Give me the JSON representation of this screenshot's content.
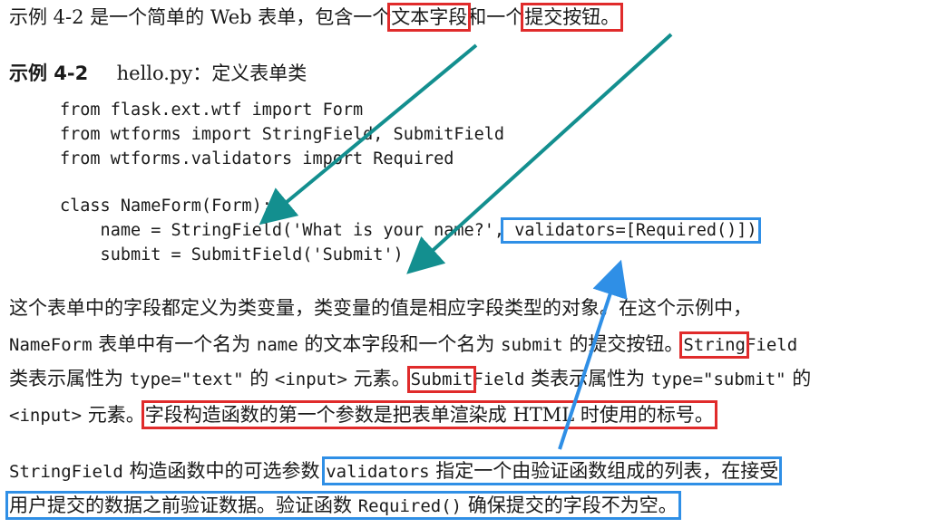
{
  "intro": {
    "text_a": "示例 4-2 是一个简单的 Web 表单，包含一个",
    "hl_text_field": "文本字段",
    "text_b": "和一个",
    "hl_submit_btn": "提交按钮。"
  },
  "caption": {
    "label": "示例 4-2",
    "title": "hello.py：定义表单类"
  },
  "code": {
    "line1": "from flask.ext.wtf import Form",
    "line2": "from wtforms import StringField, SubmitField",
    "line3": "from wtforms.validators import Required",
    "line4": "class NameForm(Form):",
    "line5a": "    name = StringField('What is your name?',",
    "line5b": " validators=[Required()])",
    "line6": "    submit = SubmitField('Submit')"
  },
  "para1": {
    "l1": "这个表单中的字段都定义为类变量，类变量的值是相应字段类型的对象。在这个示例中，",
    "l2_a": "NameForm",
    "l2_b": " 表单中有一个名为 ",
    "l2_c": "name",
    "l2_d": " 的文本字段和一个名为 ",
    "l2_e": "submit",
    "l2_f": " 的提交按钮。",
    "l2_g": "String",
    "l2_h": "Field",
    "l3_a": "类表示属性为 ",
    "l3_b": "type=\"text\"",
    "l3_c": " 的 ",
    "l3_d": "<input>",
    "l3_e": " 元素。",
    "l3_f": "Submit",
    "l3_g": "Field",
    "l3_h": " 类表示属性为 ",
    "l3_i": "type=\"submit\"",
    "l3_j": " 的",
    "l4_a": "<input>",
    "l4_b": " 元素。",
    "l4_c": "字段构造函数的第一个参数是把表单渲染成 HTML 时使用的标号。"
  },
  "para2": {
    "l1_a": "StringField",
    "l1_b": " 构造函数中的可选参数 ",
    "l1_c": "validators",
    "l1_d": " 指定一个由验证函数组成的列表，在接受",
    "l2_a": "用户提交的数据之前验证数据。验证函数 ",
    "l2_b": "Required()",
    "l2_c": " 确保提交的字段不为空。"
  },
  "colors": {
    "red_box": "#e02b2b",
    "blue_box": "#2f8fe6",
    "teal_arrow": "#138f8f"
  }
}
